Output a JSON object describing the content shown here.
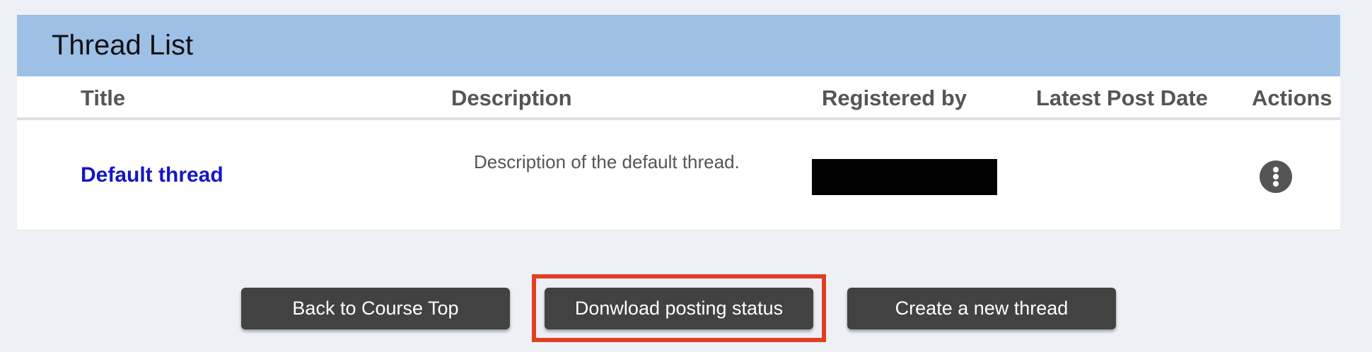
{
  "panel": {
    "title": "Thread List"
  },
  "table": {
    "headers": {
      "title": "Title",
      "description": "Description",
      "registered_by": "Registered by",
      "latest_post_date": "Latest Post Date",
      "actions": "Actions"
    },
    "rows": [
      {
        "title": "Default thread",
        "description": "Description of the default thread.",
        "registered_by": "",
        "latest_post_date": "",
        "actions_icon": "more-vertical-icon"
      }
    ]
  },
  "buttons": {
    "back": "Back to Course Top",
    "download": "Donwload posting status",
    "create": "Create a new thread"
  },
  "colors": {
    "header_background": "#9ebfe6",
    "link": "#1515c8",
    "button_background": "#424242",
    "highlight_border": "#e23e24",
    "page_background": "#edf1f5"
  }
}
